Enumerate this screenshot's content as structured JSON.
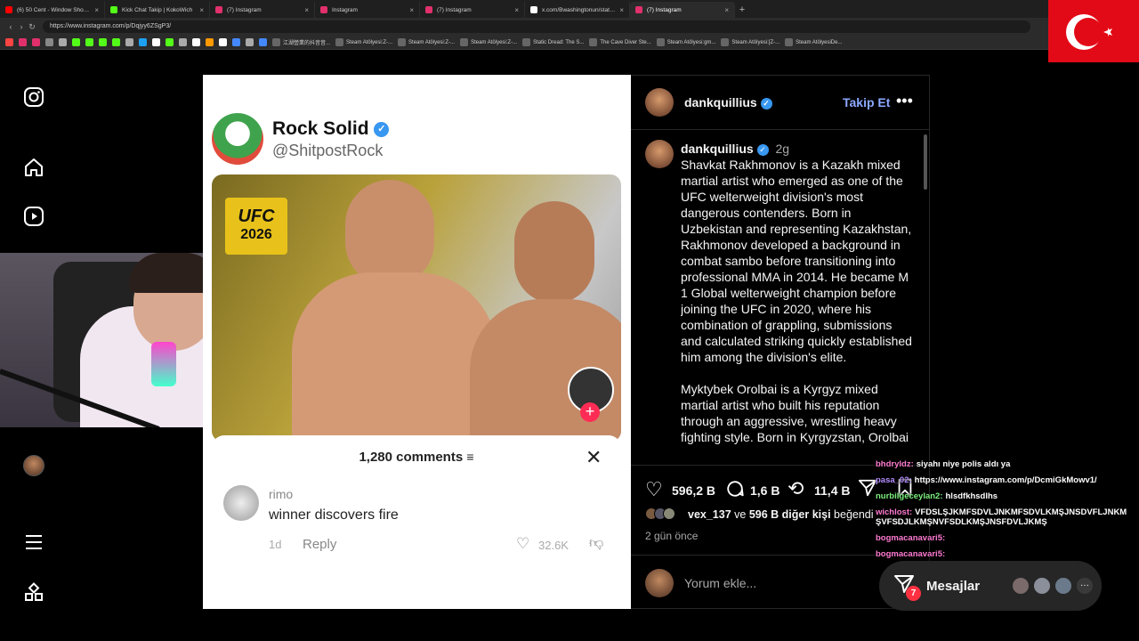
{
  "browser": {
    "tabs": [
      {
        "title": "(6) 50 Cent - Window Shopper (Ex...",
        "color": "#ff0000"
      },
      {
        "title": "Kick Chat Takip | KokoWich",
        "color": "#53fc18"
      },
      {
        "title": "(7) Instagram",
        "color": "#e1306c"
      },
      {
        "title": "Instagram",
        "color": "#e1306c"
      },
      {
        "title": "(7) Instagram",
        "color": "#e1306c"
      },
      {
        "title": "x.com/Bwashingtonun/status/20f...",
        "color": "#ffffff"
      },
      {
        "title": "(7) Instagram",
        "color": "#e1306c",
        "active": true
      }
    ],
    "url": "https://www.instagram.com/p/Dqjyy6ZSgP3/",
    "bookmarks": [
      "江湖營業的抖音音...",
      "Steam Atölyesi:Z-...",
      "Steam Atölyesi:Z-...",
      "Steam Atölyesi:Z-...",
      "Static Dread: The S...",
      "The Cave Diver Ste...",
      "Steam Atölyesi:gm...",
      "Steam Atölyesi:[Z-...",
      "Steam AtölyesiDe..."
    ]
  },
  "post_media": {
    "tweet_name": "Rock Solid",
    "tweet_handle": "@ShitpostRock",
    "ufc_logo": "UFC",
    "ufc_year": "2026",
    "comments_header": "1,280 comments",
    "comment": {
      "user": "rimo",
      "text": "winner discovers fire",
      "time": "1d",
      "reply_label": "Reply",
      "likes": "32.6K"
    }
  },
  "post_header": {
    "username": "dankquillius",
    "follow_label": "Takip Et"
  },
  "caption": {
    "username": "dankquillius",
    "time": "2g",
    "para1": "Shavkat Rakhmonov is a Kazakh mixed martial artist who emerged as one of the UFC welterweight division's most dangerous contenders. Born in Uzbekistan and representing Kazakhstan, Rakhmonov developed a background in combat sambo before transitioning into professional MMA in 2014. He became M 1 Global welterweight champion before joining the UFC in 2020, where his combination of grappling, submissions and calculated striking quickly established him among the division's elite.",
    "para2": "Myktybek Orolbai is a Kyrgyz mixed martial artist who built his reputation through an aggressive, wrestling heavy fighting style. Born in Kyrgyzstan, Orolbai"
  },
  "actions": {
    "likes": "596,2 B",
    "comments": "1,6 B",
    "reposts": "11,4 B",
    "liked_by_user": "vex_137",
    "liked_by_text": "ve",
    "liked_by_count": "596 B diğer kişi",
    "liked_by_suffix": "beğendi",
    "date": "2 gün önce",
    "comment_placeholder": "Yorum ekle..."
  },
  "chat": [
    {
      "user": "bhdryldz:",
      "msg": "siyahı niye polis aldı ya",
      "color": "#ff7ad1"
    },
    {
      "user": "pasa_02:",
      "msg": "https://www.instagram.com/p/DcmiGkMowv1/",
      "color": "#b48cff"
    },
    {
      "user": "nurbilgeceylan2:",
      "msg": "hlsdfkhsdlhs",
      "color": "#7cf07c"
    },
    {
      "user": "wichlost:",
      "msg": "VFDSLŞJKMFSDVLJNKMFSDVLKMŞJNSDVFLJNKM",
      "msg2": "ŞVFSDJLKMŞNVFSDLKMŞJNSFDVLJKMŞ",
      "color": "#ff7ad1"
    },
    {
      "user": "bogmacanavari5:",
      "msg": "",
      "color": "#ff7ad1"
    },
    {
      "user": "bogmacanavari5:",
      "msg": "",
      "color": "#ff7ad1"
    }
  ],
  "messages": {
    "label": "Mesajlar",
    "badge": "7"
  }
}
